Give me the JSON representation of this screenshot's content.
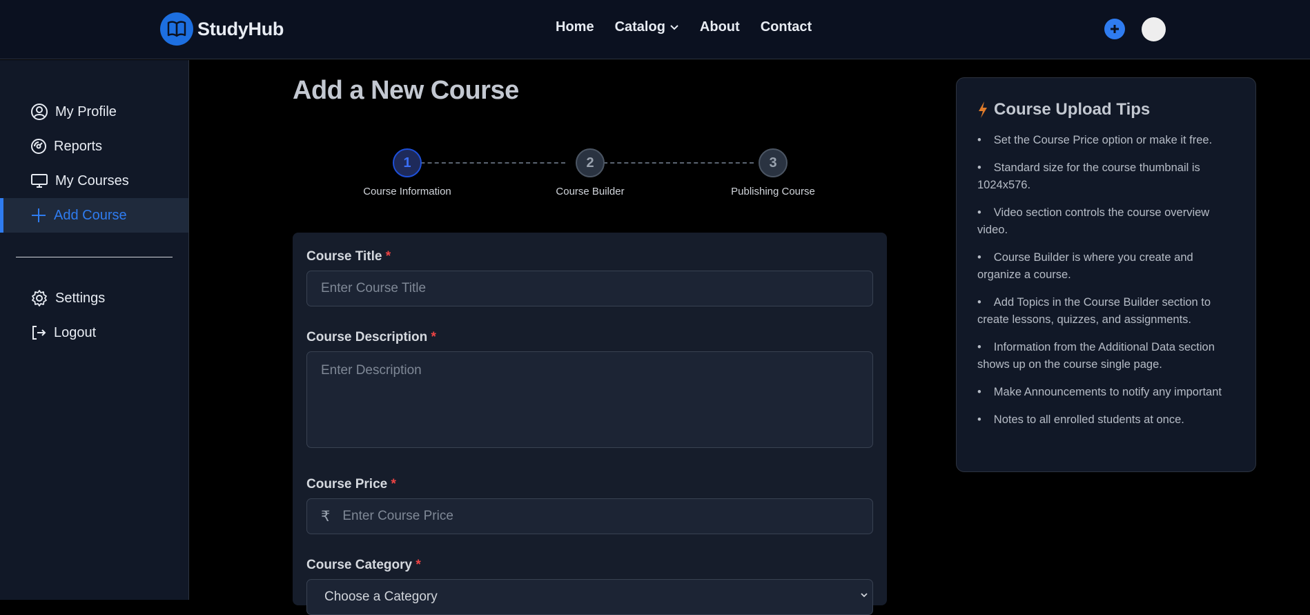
{
  "header": {
    "brand": "StudyHub",
    "nav": [
      {
        "label": "Home"
      },
      {
        "label": "Catalog"
      },
      {
        "label": "About"
      },
      {
        "label": "Contact"
      }
    ]
  },
  "sidebar": {
    "items": [
      {
        "label": "My Profile",
        "icon": "user-circle-icon"
      },
      {
        "label": "Reports",
        "icon": "gauge-icon"
      },
      {
        "label": "My Courses",
        "icon": "monitor-icon"
      },
      {
        "label": "Add Course",
        "icon": "plus-icon",
        "active": true
      }
    ],
    "bottom_items": [
      {
        "label": "Settings",
        "icon": "gear-icon"
      },
      {
        "label": "Logout",
        "icon": "logout-icon"
      }
    ]
  },
  "main": {
    "title": "Add a New Course",
    "steps": [
      {
        "number": "1",
        "label": "Course Information",
        "state": "current"
      },
      {
        "number": "2",
        "label": "Course Builder",
        "state": "pending"
      },
      {
        "number": "3",
        "label": "Publishing Course",
        "state": "pending"
      }
    ],
    "form": {
      "title_label": "Course Title",
      "title_placeholder": "Enter Course Title",
      "description_label": "Course Description",
      "description_placeholder": "Enter Description",
      "price_label": "Course Price",
      "price_symbol": "₹",
      "price_placeholder": "Enter Course Price",
      "category_label": "Course Category",
      "category_value": "Choose a Category",
      "required_mark": "*"
    }
  },
  "tips": {
    "title": "Course Upload Tips",
    "items": [
      "Set the Course Price option or make it free.",
      "Standard size for the course thumbnail is 1024x576.",
      "Video section controls the course overview video.",
      "Course Builder is where you create and organize a course.",
      "Add Topics in the Course Builder section to create lessons, quizzes, and assignments.",
      "Information from the Additional Data section shows up on the course single page.",
      "Make Announcements to notify any important",
      "Notes to all enrolled students at once."
    ]
  },
  "colors": {
    "accent": "#2f7cf0",
    "required": "#ef4444",
    "tip_icon": "#e07b2a"
  }
}
